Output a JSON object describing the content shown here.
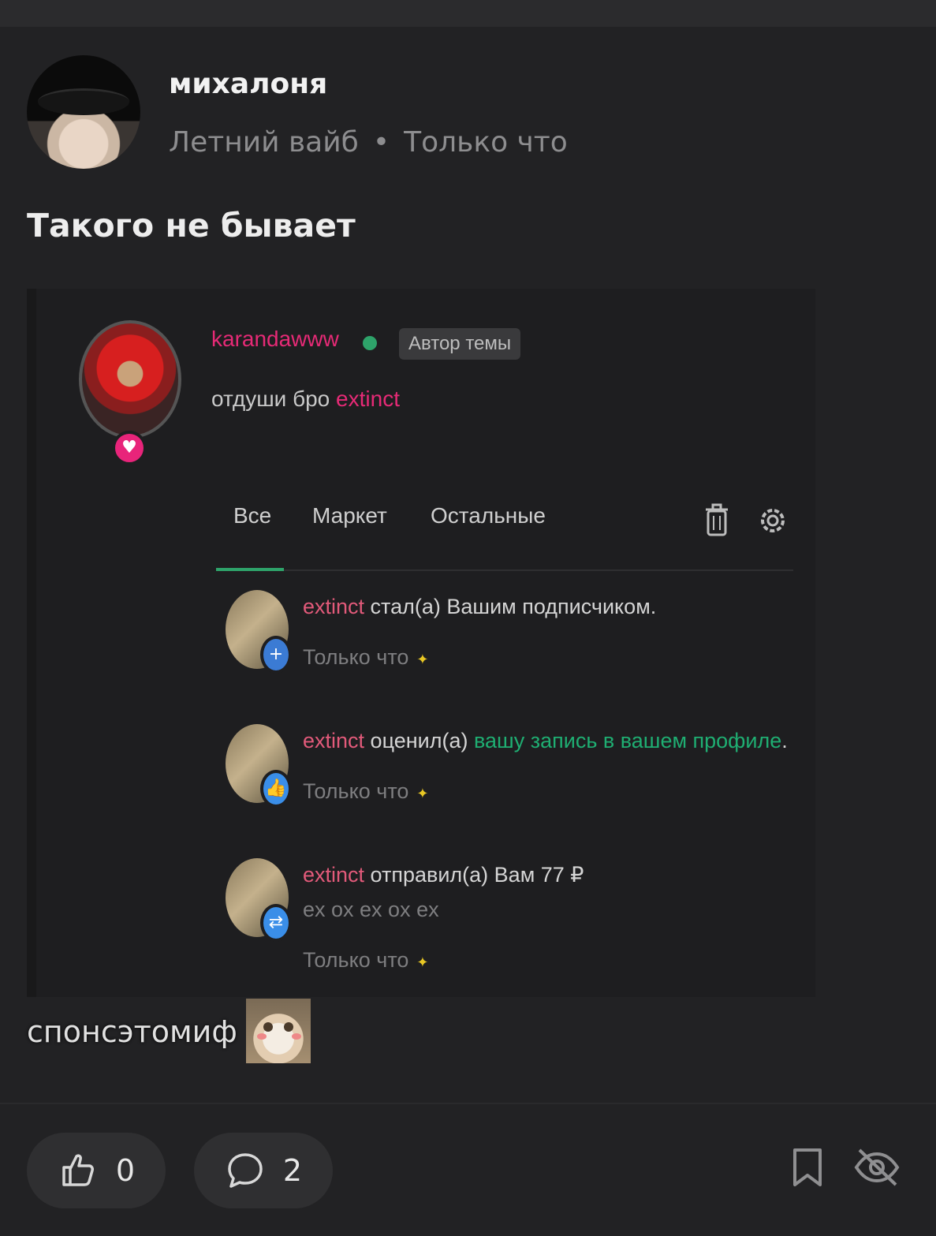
{
  "post": {
    "author": "михалоня",
    "category": "Летний вайб",
    "time": "Только что",
    "title": "Такого не бывает",
    "footer_text": "спонсэтомиф"
  },
  "screenshot": {
    "username": "karandawww",
    "badge": "Автор темы",
    "status_prefix": "отдуши бро ",
    "status_highlight": "extinct",
    "tabs": [
      "Все",
      "Маркет",
      "Остальные"
    ],
    "notifications": [
      {
        "user": "extinct",
        "text": " стал(а) Вашим подписчиком.",
        "time": "Только что",
        "badge_icon": "plus-icon",
        "badge_color": "#3b7bd4"
      },
      {
        "user": "extinct",
        "text": " оценил(а) ",
        "link": "вашу запись в вашем профиле",
        "text_end": ".",
        "time": "Только что",
        "badge_icon": "thumbs-up-icon",
        "badge_color": "#3a8ee8"
      },
      {
        "user": "extinct",
        "text": " отправил(а) Вам 77 ₽",
        "comment": "ex ox ex ox ex",
        "time": "Только что",
        "badge_icon": "transfer-icon",
        "badge_color": "#3a8ee8"
      }
    ]
  },
  "actions": {
    "likes": "0",
    "comments": "2"
  },
  "colors": {
    "background": "#222224",
    "accent_pink": "#e62a76",
    "accent_green": "#1fae72",
    "muted": "#8d8d8f"
  }
}
